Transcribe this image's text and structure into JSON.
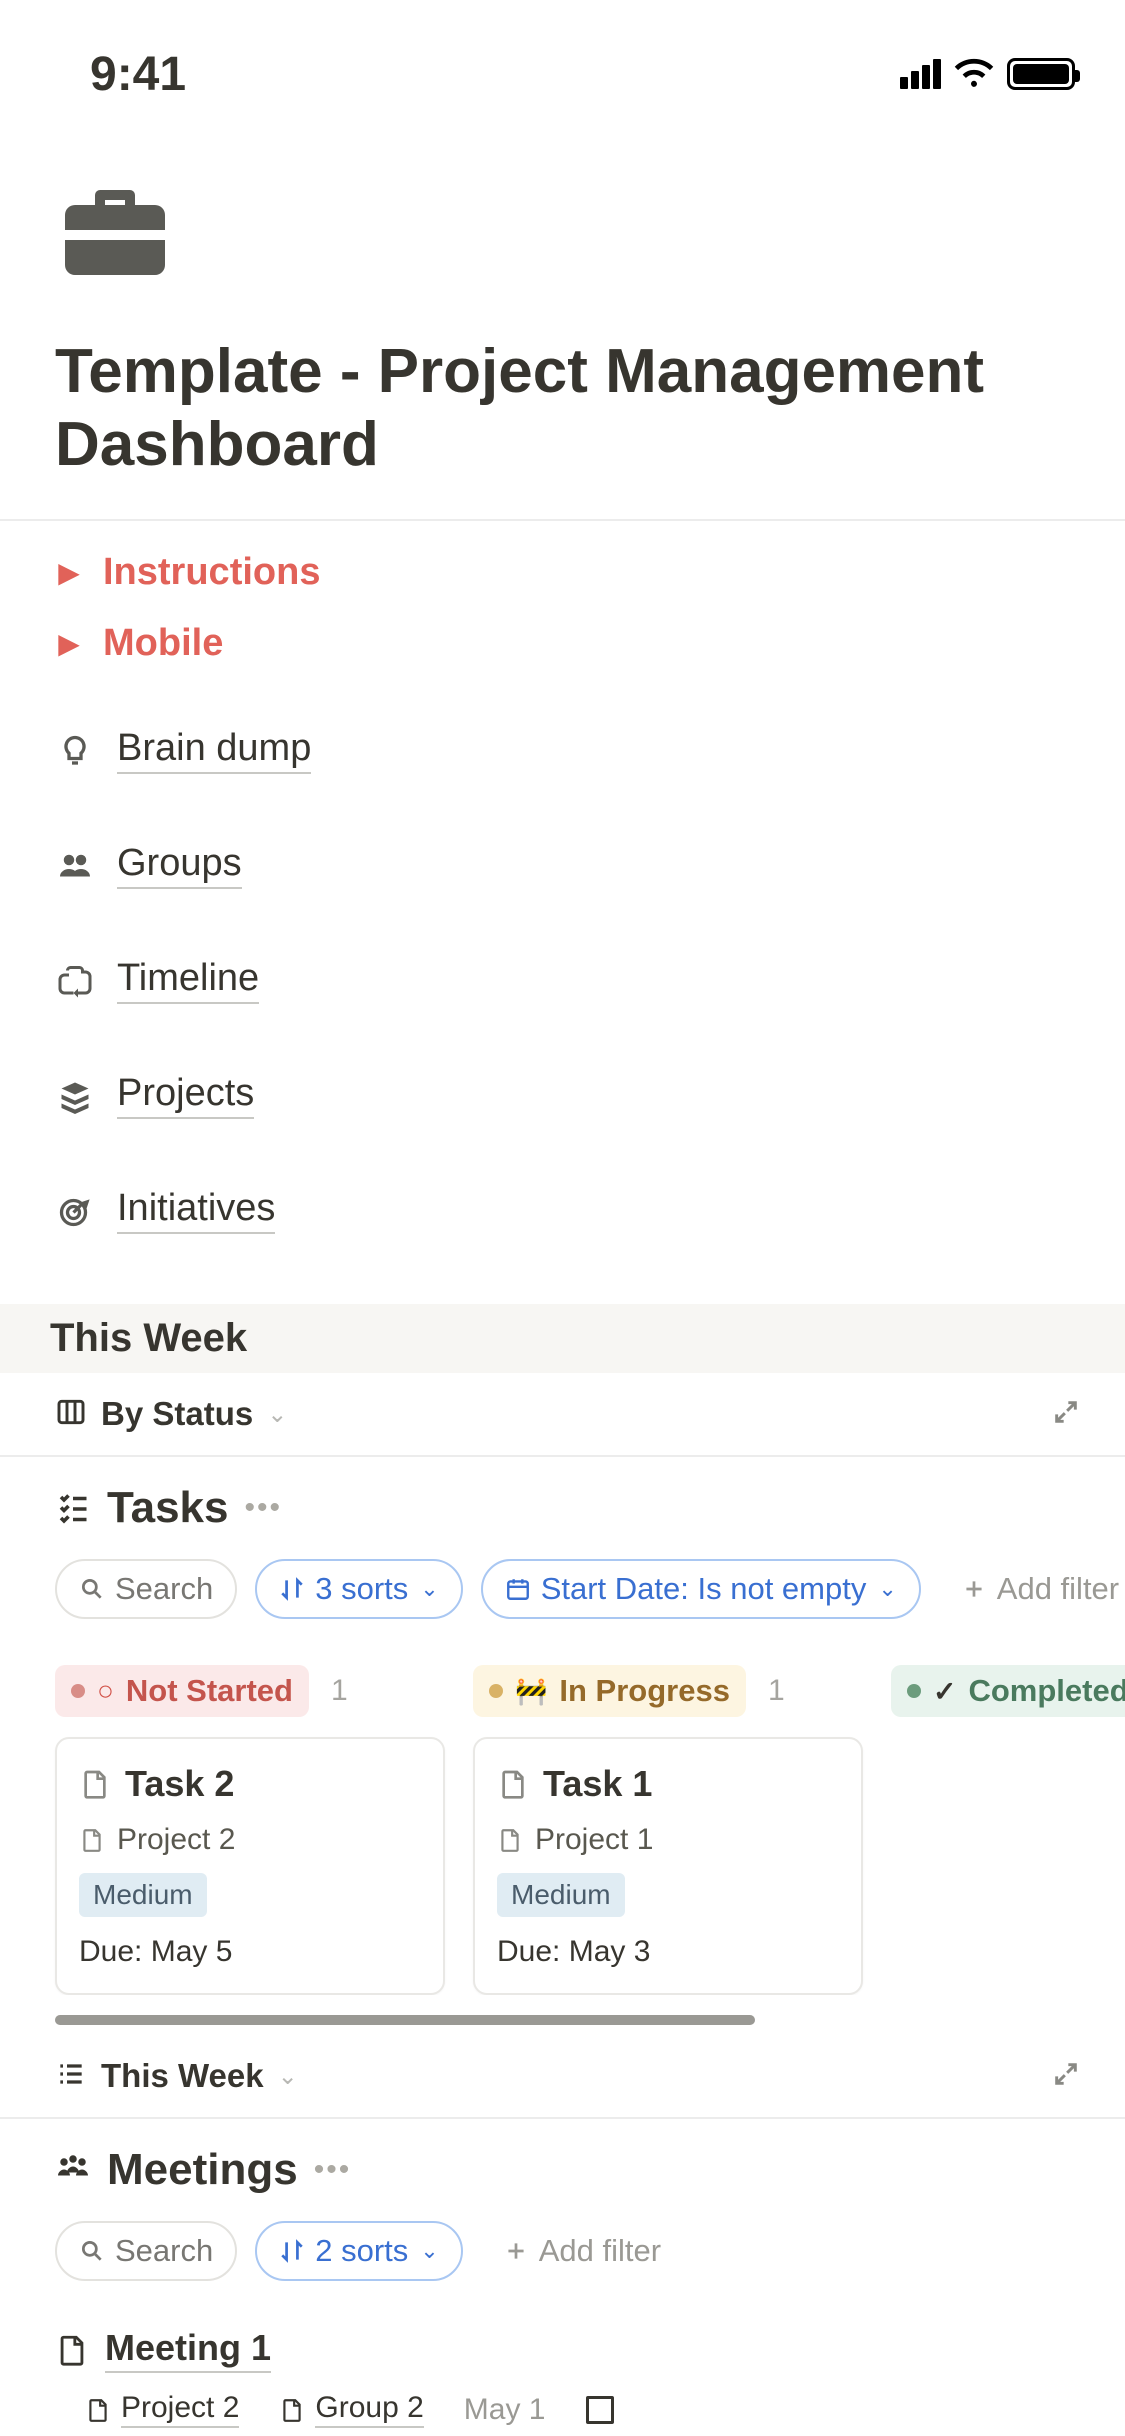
{
  "statusbar": {
    "time": "9:41"
  },
  "page": {
    "title": "Template - Project Management Dashboard"
  },
  "toggles": [
    {
      "label": "Instructions"
    },
    {
      "label": "Mobile"
    }
  ],
  "links": [
    {
      "label": "Brain dump",
      "icon": "lightbulb"
    },
    {
      "label": "Groups",
      "icon": "people"
    },
    {
      "label": "Timeline",
      "icon": "briefcase-share"
    },
    {
      "label": "Projects",
      "icon": "stack"
    },
    {
      "label": "Initiatives",
      "icon": "target"
    }
  ],
  "thisWeek": {
    "header": "This Week",
    "viewLabel": "By Status"
  },
  "tasksDB": {
    "title": "Tasks",
    "search": "Search",
    "sorts": "3 sorts",
    "filterChip": "Start Date: Is not empty",
    "addFilter": "Add filter",
    "lanes": [
      {
        "status": "Not Started",
        "count": "1"
      },
      {
        "status": "In Progress",
        "count": "1"
      },
      {
        "status": "Completed",
        "count": ""
      }
    ],
    "cards": [
      {
        "title": "Task 2",
        "project": "Project 2",
        "priority": "Medium",
        "due": "Due: May 5"
      },
      {
        "title": "Task 1",
        "project": "Project 1",
        "priority": "Medium",
        "due": "Due: May 3"
      }
    ]
  },
  "meetingsView": {
    "viewLabel": "This Week"
  },
  "meetingsDB": {
    "title": "Meetings",
    "search": "Search",
    "sorts": "2 sorts",
    "addFilter": "Add filter",
    "entry": {
      "title": "Meeting 1",
      "project": "Project 2",
      "group": "Group 2",
      "date": "May 1"
    }
  }
}
